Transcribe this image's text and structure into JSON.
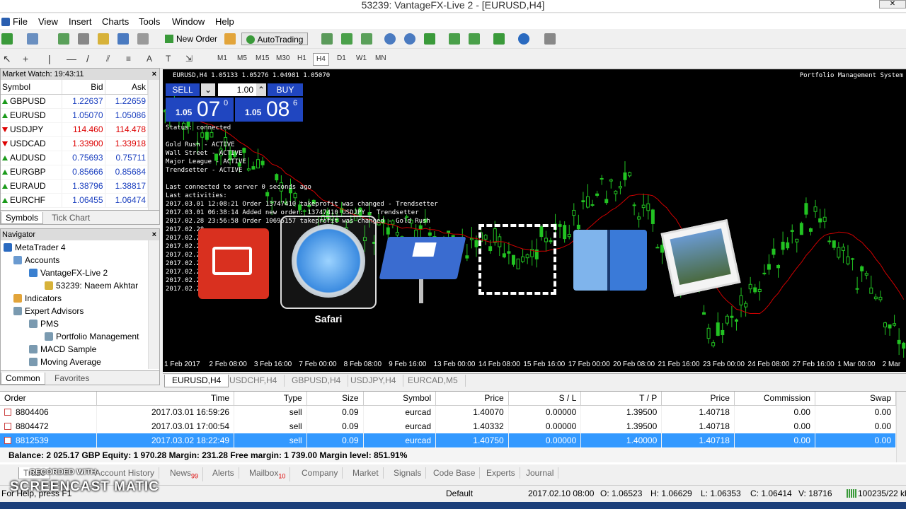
{
  "window": {
    "title": "53239: VantageFX-Live 2 - [EURUSD,H4]"
  },
  "menu": [
    "File",
    "View",
    "Insert",
    "Charts",
    "Tools",
    "Window",
    "Help"
  ],
  "toolbar": {
    "new_order": "New Order",
    "autotrading": "AutoTrading"
  },
  "timeframes": [
    "M1",
    "M5",
    "M15",
    "M30",
    "H1",
    "H4",
    "D1",
    "W1",
    "MN"
  ],
  "timeframe_active": "H4",
  "market_watch": {
    "title": "Market Watch: 19:43:11",
    "columns": [
      "Symbol",
      "Bid",
      "Ask"
    ],
    "rows": [
      {
        "symbol": "GBPUSD",
        "bid": "1.22637",
        "ask": "1.22659",
        "dir": "up"
      },
      {
        "symbol": "EURUSD",
        "bid": "1.05070",
        "ask": "1.05086",
        "dir": "up"
      },
      {
        "symbol": "USDJPY",
        "bid": "114.460",
        "ask": "114.478",
        "dir": "dn"
      },
      {
        "symbol": "USDCAD",
        "bid": "1.33900",
        "ask": "1.33918",
        "dir": "dn"
      },
      {
        "symbol": "AUDUSD",
        "bid": "0.75693",
        "ask": "0.75711",
        "dir": "up"
      },
      {
        "symbol": "EURGBP",
        "bid": "0.85666",
        "ask": "0.85684",
        "dir": "up"
      },
      {
        "symbol": "EURAUD",
        "bid": "1.38796",
        "ask": "1.38817",
        "dir": "up"
      },
      {
        "symbol": "EURCHF",
        "bid": "1.06455",
        "ask": "1.06474",
        "dir": "up"
      }
    ],
    "tabs": [
      "Symbols",
      "Tick Chart"
    ]
  },
  "navigator": {
    "title": "Navigator",
    "items": {
      "root": "MetaTrader 4",
      "accounts": "Accounts",
      "server": "VantageFX-Live 2",
      "account": "53239: Naeem Akhtar",
      "indicators": "Indicators",
      "experts": "Expert Advisors",
      "pms": "PMS",
      "portfolio": "Portfolio Management",
      "macd": "MACD Sample",
      "ma": "Moving Average"
    },
    "tabs": [
      "Common",
      "Favorites"
    ]
  },
  "chart": {
    "header": "EURUSD,H4  1.05133 1.05276 1.04981 1.05070",
    "ea_name": "Portfolio Management System",
    "sell_label": "SELL",
    "buy_label": "BUY",
    "volume": "1.00",
    "sell_price": {
      "prefix": "1.05",
      "big": "07",
      "sup": "0"
    },
    "buy_price": {
      "prefix": "1.05",
      "big": "08",
      "sup": "6"
    },
    "status_lines": [
      "Status: connected",
      "",
      "Gold Rush - ACTIVE",
      "Wall Street - ACTIVE",
      "Major League - ACTIVE",
      "Trendsetter - ACTIVE",
      "",
      "Last connected to server 0 seconds ago",
      "Last activities:",
      "2017.03.01 12:08:21 Order 13747410 takeprofit was changed - Trendsetter",
      "2017.03.01 06:38:14 Added new order: 13747410 USDJPY - Trendsetter",
      "2017.02.28 23:56:58 Order 10696157 takeprofit was changed - Gold Rush",
      "2017.02.28",
      "2017.02.28",
      "2017.02.28",
      "2017.02.28",
      "2017.02.28",
      "2017.02.28",
      "2017.02.28",
      "2017.02.28"
    ],
    "x_labels": [
      "1 Feb 2017",
      "2 Feb 08:00",
      "3 Feb 16:00",
      "7 Feb 00:00",
      "8 Feb 08:00",
      "9 Feb 16:00",
      "13 Feb 00:00",
      "14 Feb 08:00",
      "15 Feb 16:00",
      "17 Feb 00:00",
      "20 Feb 08:00",
      "21 Feb 16:00",
      "23 Feb 00:00",
      "24 Feb 08:00",
      "27 Feb 16:00",
      "1 Mar 00:00",
      "2 Mar"
    ],
    "tabs": [
      "EURUSD,H4",
      "USDCHF,H4",
      "GBPUSD,H4",
      "USDJPY,H4",
      "EURCAD,M5"
    ]
  },
  "dock": {
    "safari_label": "Safari"
  },
  "terminal": {
    "columns": [
      "Order",
      "Time",
      "Type",
      "Size",
      "Symbol",
      "Price",
      "S / L",
      "T / P",
      "Price",
      "Commission",
      "Swap"
    ],
    "rows": [
      [
        "8804406",
        "2017.03.01 16:59:26",
        "sell",
        "0.09",
        "eurcad",
        "1.40070",
        "0.00000",
        "1.39500",
        "1.40718",
        "0.00",
        "0.00"
      ],
      [
        "8804472",
        "2017.03.01 17:00:54",
        "sell",
        "0.09",
        "eurcad",
        "1.40332",
        "0.00000",
        "1.39500",
        "1.40718",
        "0.00",
        "0.00"
      ],
      [
        "8812539",
        "2017.03.02 18:22:49",
        "sell",
        "0.09",
        "eurcad",
        "1.40750",
        "0.00000",
        "1.40000",
        "1.40718",
        "0.00",
        "0.00"
      ]
    ],
    "balance": "Balance: 2 025.17 GBP  Equity: 1 970.28  Margin: 231.28  Free margin: 1 739.00  Margin level: 851.91%",
    "tabs": [
      {
        "label": "Trade",
        "badge": ""
      },
      {
        "label": "Account History",
        "badge": ""
      },
      {
        "label": "News",
        "badge": "99"
      },
      {
        "label": "Alerts",
        "badge": ""
      },
      {
        "label": "Mailbox",
        "badge": "10"
      },
      {
        "label": "Company",
        "badge": ""
      },
      {
        "label": "Market",
        "badge": ""
      },
      {
        "label": "Signals",
        "badge": ""
      },
      {
        "label": "Code Base",
        "badge": ""
      },
      {
        "label": "Experts",
        "badge": ""
      },
      {
        "label": "Journal",
        "badge": ""
      }
    ]
  },
  "status": {
    "help": "For Help, press F1",
    "profile": "Default",
    "datetime": "2017.02.10 08:00",
    "open": "O: 1.06523",
    "high": "H: 1.06629",
    "low": "L: 1.06353",
    "close": "C: 1.06414",
    "volume": "V: 18716",
    "traffic": "100235/22 kb"
  },
  "watermark": {
    "recorded": "RECORDED WITH",
    "brand": "SCREENCAST  MATIC"
  },
  "colors": {
    "chart_bg": "#000000",
    "candle": "#22c322",
    "ma": "#d00000",
    "sel_row": "#3399ff",
    "panel_blue": "#2046c0"
  }
}
